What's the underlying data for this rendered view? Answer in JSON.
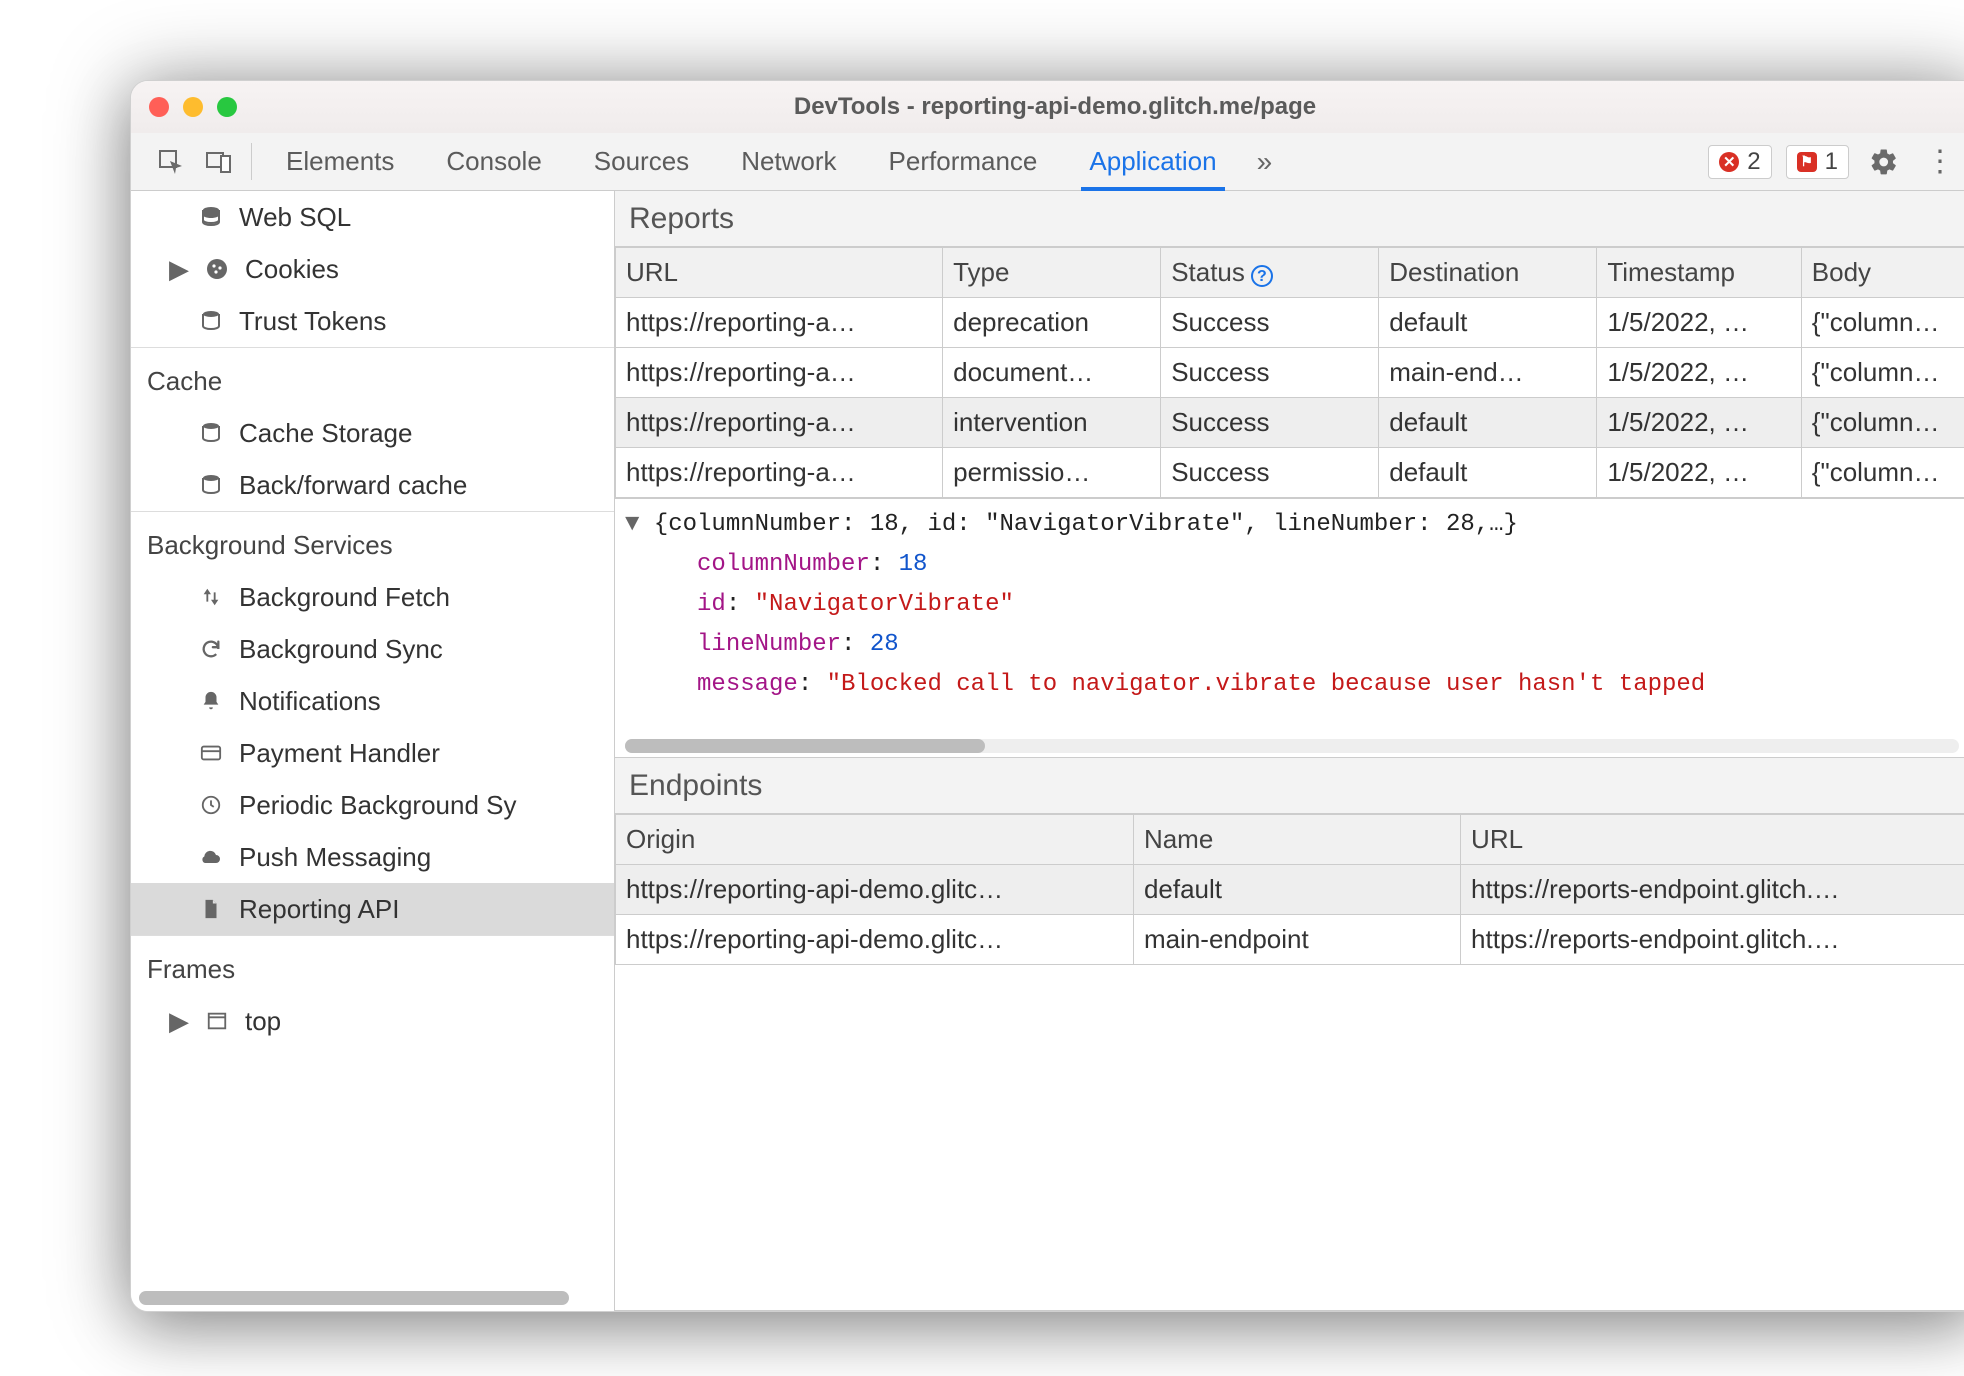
{
  "window": {
    "title": "DevTools - reporting-api-demo.glitch.me/page"
  },
  "toolbar": {
    "tabs": [
      "Elements",
      "Console",
      "Sources",
      "Network",
      "Performance",
      "Application"
    ],
    "active_tab_index": 5,
    "errors_count": "2",
    "issues_count": "1"
  },
  "sidebar": {
    "storage_items": [
      {
        "icon": "database",
        "label": "Web SQL"
      },
      {
        "icon": "cookie",
        "label": "Cookies",
        "expandable": true
      },
      {
        "icon": "database",
        "label": "Trust Tokens"
      }
    ],
    "cache_header": "Cache",
    "cache_items": [
      {
        "icon": "database",
        "label": "Cache Storage"
      },
      {
        "icon": "database",
        "label": "Back/forward cache"
      }
    ],
    "bg_header": "Background Services",
    "bg_items": [
      {
        "icon": "updown",
        "label": "Background Fetch"
      },
      {
        "icon": "sync",
        "label": "Background Sync"
      },
      {
        "icon": "bell",
        "label": "Notifications"
      },
      {
        "icon": "card",
        "label": "Payment Handler"
      },
      {
        "icon": "clock",
        "label": "Periodic Background Sy"
      },
      {
        "icon": "cloud",
        "label": "Push Messaging"
      },
      {
        "icon": "file",
        "label": "Reporting API",
        "selected": true
      }
    ],
    "frames_header": "Frames",
    "frames_items": [
      {
        "icon": "window",
        "label": "top",
        "expandable": true
      }
    ]
  },
  "reports": {
    "title": "Reports",
    "columns": [
      "URL",
      "Type",
      "Status",
      "Destination",
      "Timestamp",
      "Body"
    ],
    "rows": [
      {
        "url": "https://reporting-a…",
        "type": "deprecation",
        "status": "Success",
        "dest": "default",
        "ts": "1/5/2022, …",
        "body": "{\"column…"
      },
      {
        "url": "https://reporting-a…",
        "type": "document…",
        "status": "Success",
        "dest": "main-end…",
        "ts": "1/5/2022, …",
        "body": "{\"column…"
      },
      {
        "url": "https://reporting-a…",
        "type": "intervention",
        "status": "Success",
        "dest": "default",
        "ts": "1/5/2022, …",
        "body": "{\"column…",
        "selected": true
      },
      {
        "url": "https://reporting-a…",
        "type": "permissio…",
        "status": "Success",
        "dest": "default",
        "ts": "1/5/2022, …",
        "body": "{\"column…"
      }
    ]
  },
  "detail": {
    "summary": "{columnNumber: 18, id: \"NavigatorVibrate\", lineNumber: 28,…}",
    "entries": {
      "columnNumber": "18",
      "id": "\"NavigatorVibrate\"",
      "lineNumber": "28",
      "message": "\"Blocked call to navigator.vibrate because user hasn't tapped"
    },
    "keys": {
      "columnNumber": "columnNumber",
      "id": "id",
      "lineNumber": "lineNumber",
      "message": "message"
    }
  },
  "endpoints": {
    "title": "Endpoints",
    "columns": [
      "Origin",
      "Name",
      "URL"
    ],
    "rows": [
      {
        "origin": "https://reporting-api-demo.glitc…",
        "name": "default",
        "url": "https://reports-endpoint.glitch.…",
        "selected": true
      },
      {
        "origin": "https://reporting-api-demo.glitc…",
        "name": "main-endpoint",
        "url": "https://reports-endpoint.glitch.…"
      }
    ]
  }
}
